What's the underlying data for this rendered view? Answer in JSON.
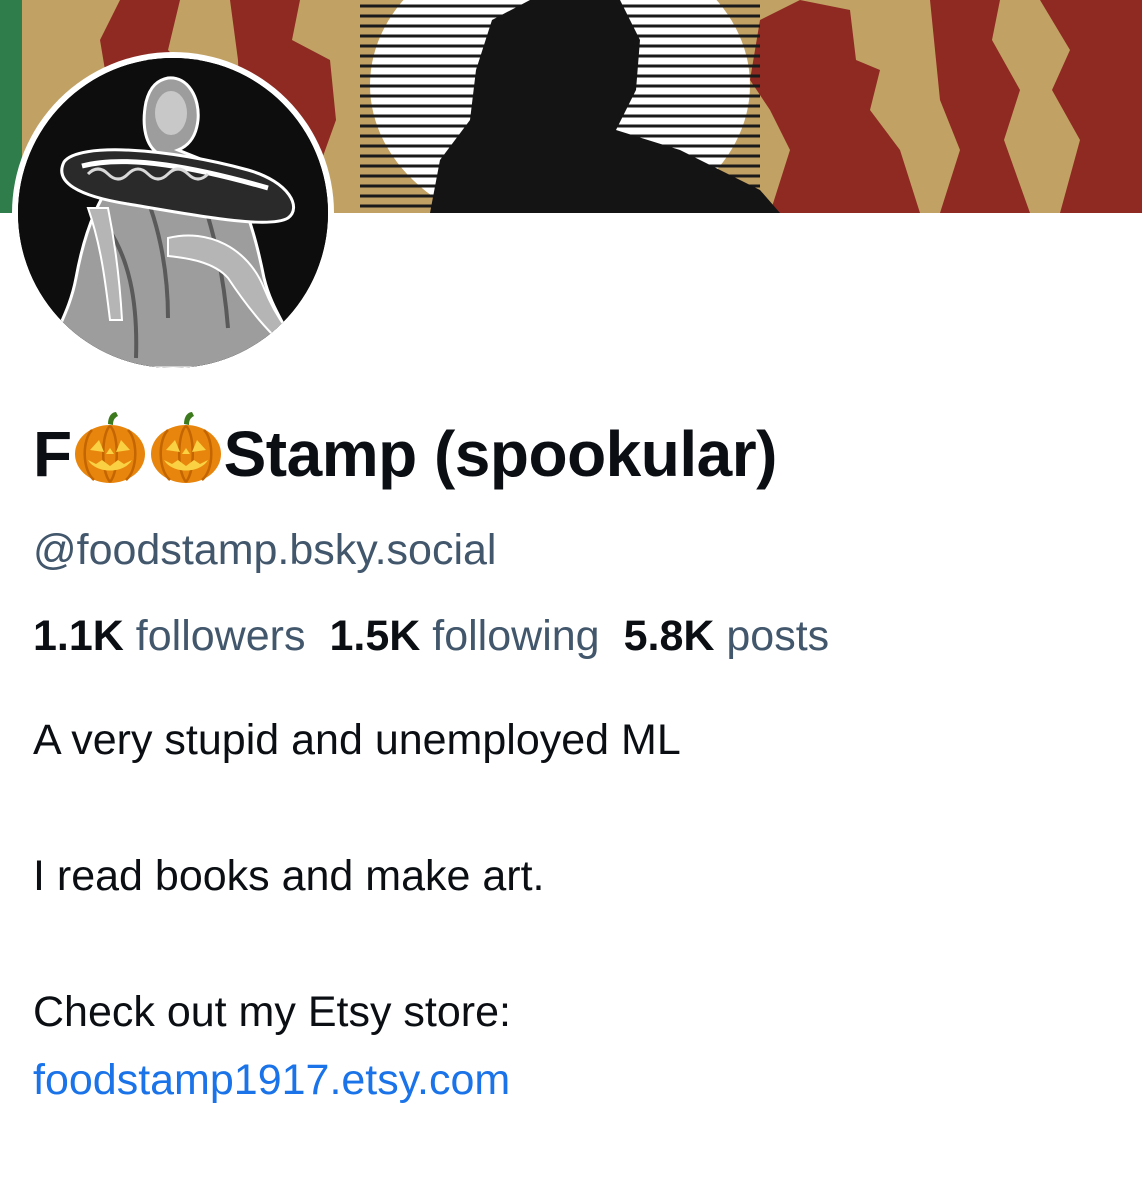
{
  "profile": {
    "display_name_prefix": "F",
    "display_name_emoji": "jack-o-lantern-icon",
    "display_name_suffix": "Stamp (spookular)",
    "handle": "@foodstamp.bsky.social"
  },
  "stats": {
    "followers_count": "1.1K",
    "followers_label": "followers",
    "following_count": "1.5K",
    "following_label": "following",
    "posts_count": "5.8K",
    "posts_label": "posts"
  },
  "bio": {
    "line1": "A very stupid and unemployed ML",
    "line2": "I read books and make art.",
    "line3": "Check out my Etsy store:",
    "link_text": "foodstamp1917.etsy.com"
  },
  "colors": {
    "text_primary": "#0b0f14",
    "text_secondary": "#42576c",
    "link": "#1a73e8",
    "banner_tan": "#c2a164",
    "banner_red": "#8e2a22"
  }
}
